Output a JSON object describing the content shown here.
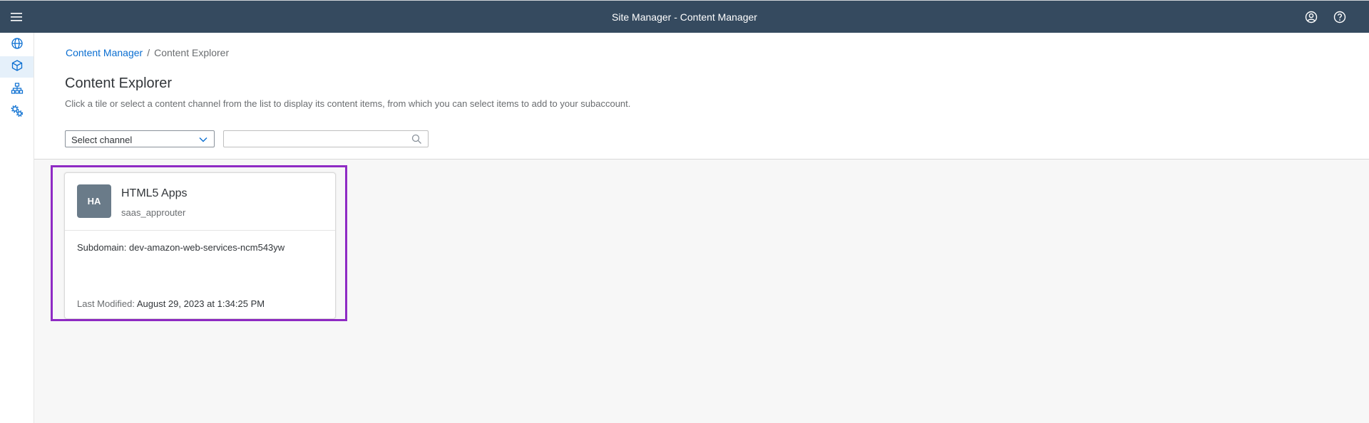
{
  "shellbar": {
    "title": "Site Manager - Content Manager",
    "icons": [
      "menu-icon",
      "user-icon",
      "help-icon"
    ]
  },
  "sidenav": {
    "items": [
      {
        "name": "globe-icon",
        "active": false
      },
      {
        "name": "cube-icon",
        "active": true
      },
      {
        "name": "hierarchy-icon",
        "active": false
      },
      {
        "name": "settings-gears-icon",
        "active": false
      }
    ]
  },
  "breadcrumb": {
    "link": "Content Manager",
    "separator": "/",
    "current": "Content Explorer"
  },
  "page": {
    "title": "Content Explorer",
    "description": "Click a tile or select a content channel from the list to display its content items, from which you can select items to add to your subaccount."
  },
  "filters": {
    "channel_select": "Select channel",
    "search_value": "",
    "search_placeholder": ""
  },
  "tiles": [
    {
      "initials": "HA",
      "title": "HTML5 Apps",
      "subtitle": "saas_approuter",
      "subdomain": "Subdomain: dev-amazon-web-services-ncm543yw",
      "modified_label": "Last Modified:",
      "modified_value": "August 29, 2023 at 1:34:25 PM"
    }
  ],
  "colors": {
    "shellbar": "#354a5f",
    "link": "#0a6ed1",
    "highlight": "#8f2bc4",
    "avatar": "#6a7b89"
  }
}
